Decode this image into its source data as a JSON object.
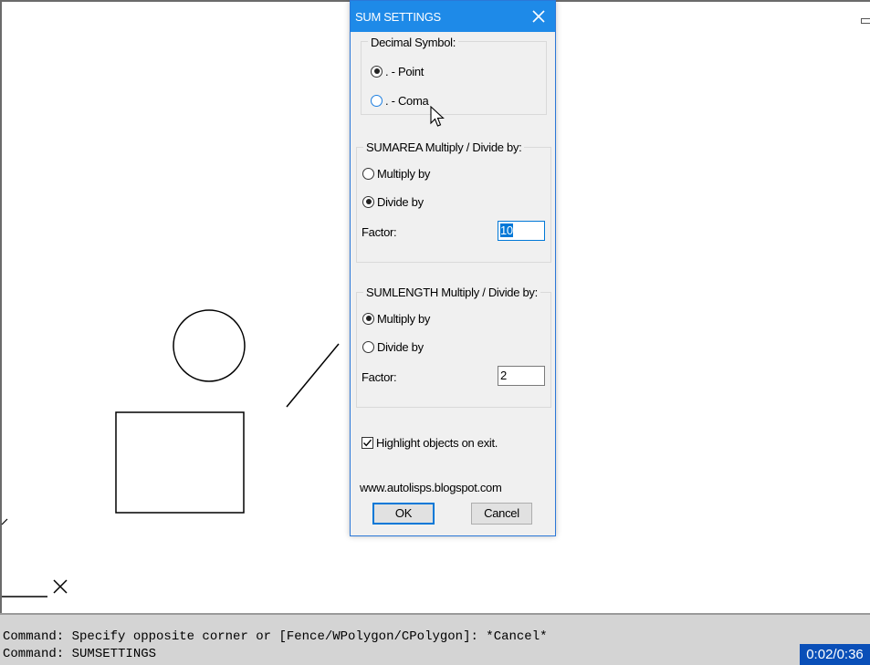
{
  "dialog": {
    "title": "SUM SETTINGS",
    "decimal_group": {
      "legend": "Decimal Symbol:",
      "options": [
        {
          "label": ". - Point",
          "selected": true
        },
        {
          "label": ". - Coma",
          "selected": false
        }
      ]
    },
    "sumarea_group": {
      "legend": "SUMAREA Multiply / Divide by:",
      "options": [
        {
          "label": "Multiply by",
          "selected": false
        },
        {
          "label": "Divide by",
          "selected": true
        }
      ],
      "factor_label": "Factor:",
      "factor_value": "10"
    },
    "sumlength_group": {
      "legend": "SUMLENGTH Multiply / Divide by:",
      "options": [
        {
          "label": "Multiply by",
          "selected": true
        },
        {
          "label": "Divide by",
          "selected": false
        }
      ],
      "factor_label": "Factor:",
      "factor_value": "2"
    },
    "highlight_checkbox": {
      "label": "Highlight objects on exit.",
      "checked": true
    },
    "website": "www.autolisps.blogspot.com",
    "ok_label": "OK",
    "cancel_label": "Cancel"
  },
  "command_line": {
    "lines": [
      "Command: Specify opposite corner or [Fence/WPolygon/CPolygon]: *Cancel*",
      "Command: SUMSETTINGS"
    ]
  },
  "video_timer": "0:02/0:36",
  "colors": {
    "titlebar": "#1e8ae8",
    "accent": "#0078d7",
    "timer_bg": "#0a4fb8"
  }
}
